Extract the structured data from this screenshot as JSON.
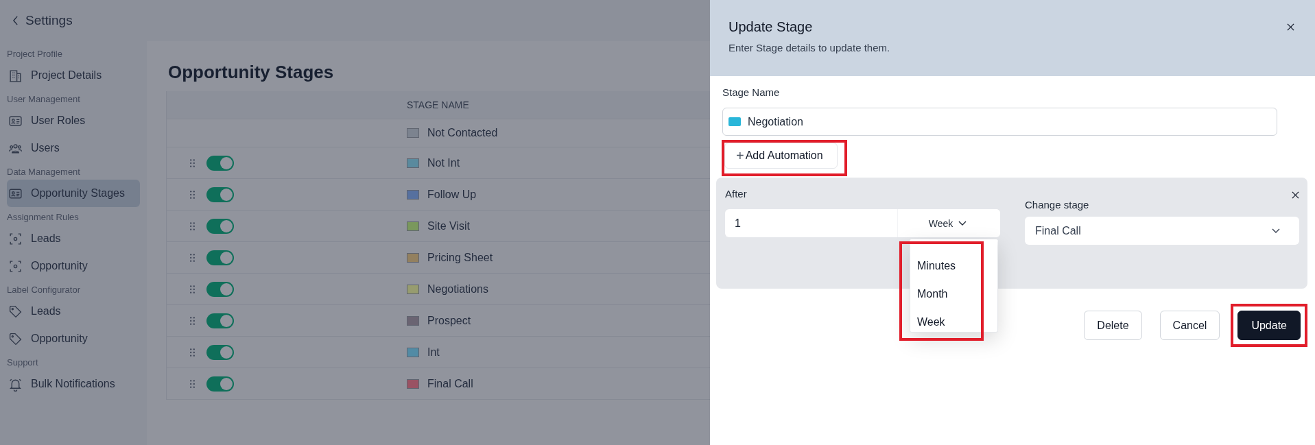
{
  "topbar": {
    "back_label": "Settings"
  },
  "sidebar": {
    "sections": [
      {
        "title": "Project Profile",
        "items": [
          {
            "label": "Project Details",
            "selected": false
          }
        ]
      },
      {
        "title": "User Management",
        "items": [
          {
            "label": "User Roles",
            "selected": false
          },
          {
            "label": "Users",
            "selected": false
          }
        ]
      },
      {
        "title": "Data Management",
        "items": [
          {
            "label": "Opportunity Stages",
            "selected": true
          }
        ]
      },
      {
        "title": "Assignment Rules",
        "items": [
          {
            "label": "Leads",
            "selected": false
          },
          {
            "label": "Opportunity",
            "selected": false
          }
        ]
      },
      {
        "title": "Label Configurator",
        "items": [
          {
            "label": "Leads",
            "selected": false
          },
          {
            "label": "Opportunity",
            "selected": false
          }
        ]
      },
      {
        "title": "Support",
        "items": [
          {
            "label": "Bulk Notifications",
            "selected": false
          }
        ]
      }
    ]
  },
  "page": {
    "title": "Opportunity Stages"
  },
  "table": {
    "columns": [
      "STAGE NAME"
    ],
    "rows": [
      {
        "kind": "locked",
        "name": "Not Contacted",
        "color": "#7c838f"
      },
      {
        "kind": "toggleable",
        "on": true,
        "name": "Not Int",
        "color": "#5a8a9e"
      },
      {
        "kind": "toggleable",
        "on": true,
        "name": "Follow Up",
        "color": "#56709f"
      },
      {
        "kind": "toggleable",
        "on": true,
        "name": "Site Visit",
        "color": "#7a985c"
      },
      {
        "kind": "toggleable",
        "on": true,
        "name": "Pricing Sheet",
        "color": "#93805f"
      },
      {
        "kind": "toggleable",
        "on": true,
        "name": "Negotiations",
        "color": "#979c6f"
      },
      {
        "kind": "toggleable",
        "on": true,
        "name": "Prospect",
        "color": "#6a6472"
      },
      {
        "kind": "toggleable",
        "on": true,
        "name": "Int",
        "color": "#528ba5"
      },
      {
        "kind": "toggleable",
        "on": true,
        "name": "Final Call",
        "color": "#9a5263"
      }
    ]
  },
  "drawer": {
    "title": "Update Stage",
    "subtitle": "Enter Stage details to update them.",
    "stage_name": {
      "label": "Stage Name",
      "value": "Negotiation",
      "color": "#29b6d9"
    },
    "add_automation": {
      "plus": "+",
      "label": "Add Automation",
      "highlighted": true
    },
    "automation": {
      "after_label": "After",
      "after_value": "1",
      "unit": "Week",
      "change_label": "Change stage",
      "change_value": "Final Call",
      "unit_menu": {
        "open": true,
        "highlighted": true,
        "options": [
          "Minutes",
          "Month",
          "Week"
        ]
      }
    },
    "buttons": [
      {
        "kind": "secondary",
        "label": "Delete",
        "highlighted": false
      },
      {
        "kind": "secondary",
        "label": "Cancel",
        "highlighted": false
      },
      {
        "kind": "primary",
        "label": "Update",
        "highlighted": true
      }
    ]
  }
}
